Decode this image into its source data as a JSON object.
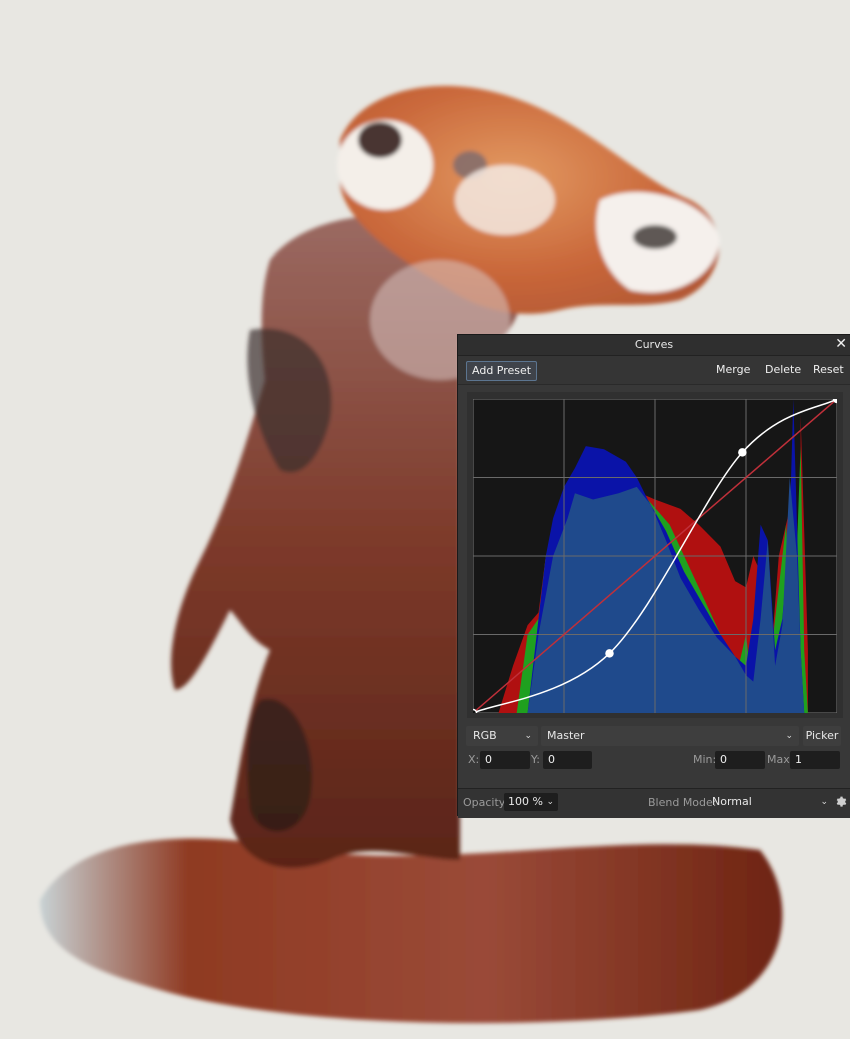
{
  "panel": {
    "title": "Curves",
    "close_icon": "close-icon",
    "toolbar": {
      "add_preset": "Add Preset",
      "merge": "Merge",
      "delete": "Delete",
      "reset": "Reset"
    },
    "controls": {
      "color_space": "RGB",
      "channel": "Master",
      "picker": "Picker",
      "x_label": "X:",
      "x_value": "0",
      "y_label": "Y:",
      "y_value": "0",
      "min_label": "Min:",
      "min_value": "0",
      "max_label": "Max:",
      "max_value": "1"
    },
    "footer": {
      "opacity_label": "Opacity:",
      "opacity_value": "100 %",
      "blend_label": "Blend Mode:",
      "blend_value": "Normal",
      "settings_icon": "gear-icon"
    }
  },
  "colors": {
    "hist_red": "#b01010",
    "hist_green": "#1fa01f",
    "hist_blue": "#0a13a8",
    "hist_overlap": "#1f4a8c",
    "curve": "#ffffff",
    "diagonal": "#c0303a",
    "graph_bg": "#161616"
  },
  "curve_points": [
    {
      "x": 0.0,
      "y": 0.0
    },
    {
      "x": 0.375,
      "y": 0.19
    },
    {
      "x": 0.74,
      "y": 0.83
    },
    {
      "x": 1.0,
      "y": 1.0
    }
  ]
}
